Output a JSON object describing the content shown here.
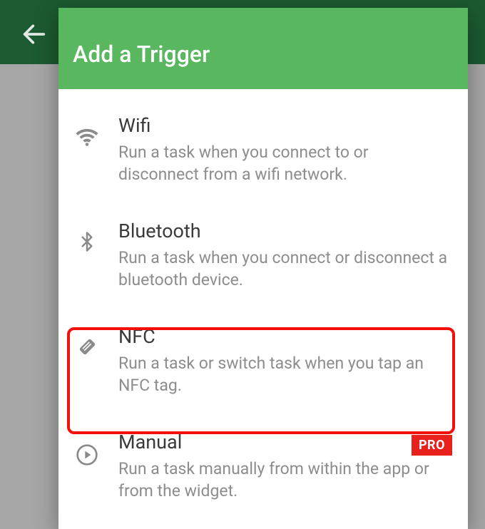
{
  "dialog": {
    "title": "Add a Trigger"
  },
  "triggers": [
    {
      "icon": "wifi-icon",
      "title": "Wifi",
      "desc": "Run a task when you connect to or disconnect from a wifi network."
    },
    {
      "icon": "bluetooth-icon",
      "title": "Bluetooth",
      "desc": "Run a task when you connect or disconnect a bluetooth device."
    },
    {
      "icon": "nfc-tag-icon",
      "title": "NFC",
      "desc": "Run a task or switch task when you tap an NFC tag."
    },
    {
      "icon": "play-icon",
      "title": "Manual",
      "desc": "Run a task manually from within the app or from the widget.",
      "badge": "PRO"
    }
  ],
  "highlighted_index": 2,
  "colors": {
    "accent": "#59b760",
    "topbar": "#1c5a32",
    "highlight_border": "#f30f0a",
    "pro_badge": "#e9211d"
  }
}
